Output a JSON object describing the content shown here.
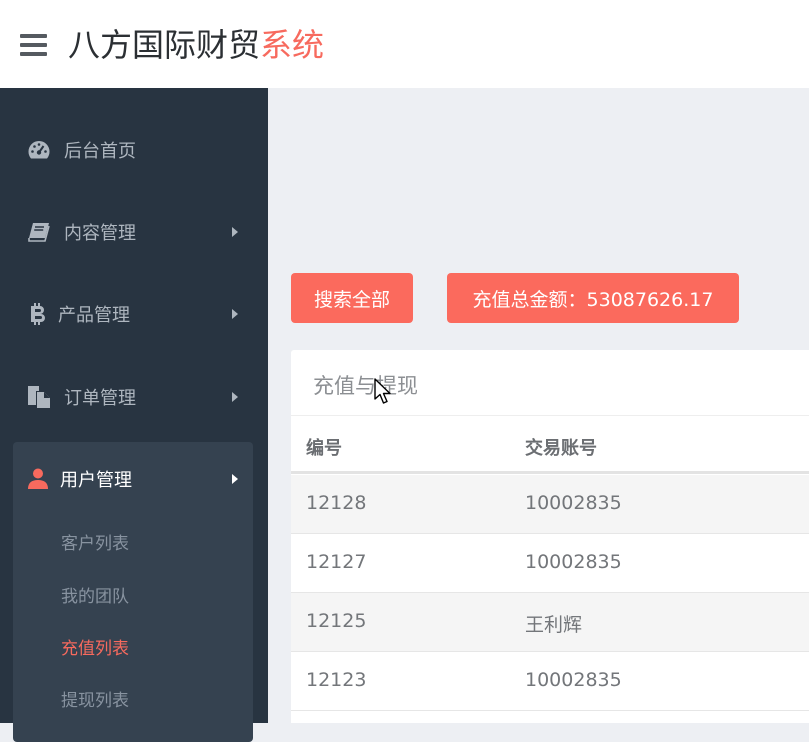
{
  "header": {
    "brand_main": "八方国际财贸",
    "brand_accent": "系统"
  },
  "sidebar": {
    "items": [
      {
        "label": "后台首页",
        "icon": "dashboard-icon"
      },
      {
        "label": "内容管理",
        "icon": "book-icon"
      },
      {
        "label": "产品管理",
        "icon": "bitcoin-icon"
      },
      {
        "label": "订单管理",
        "icon": "file-copy-icon"
      },
      {
        "label": "用户管理",
        "icon": "user-icon"
      }
    ],
    "sub_items": [
      {
        "label": "客户列表"
      },
      {
        "label": "我的团队"
      },
      {
        "label": "充值列表"
      },
      {
        "label": "提现列表"
      }
    ]
  },
  "toolbar": {
    "search_all_label": "搜索全部",
    "total_recharge_label": "充值总金额：53087626.17"
  },
  "panel": {
    "title": "充值与提现",
    "columns": [
      "编号",
      "交易账号"
    ],
    "rows": [
      [
        "12128",
        "10002835"
      ],
      [
        "12127",
        "10002835"
      ],
      [
        "12125",
        "王利辉"
      ],
      [
        "12123",
        "10002835"
      ]
    ]
  },
  "colors": {
    "accent": "#fb6a5d",
    "sidebar_bg": "#283441",
    "sidebar_active_bg": "#354250"
  }
}
